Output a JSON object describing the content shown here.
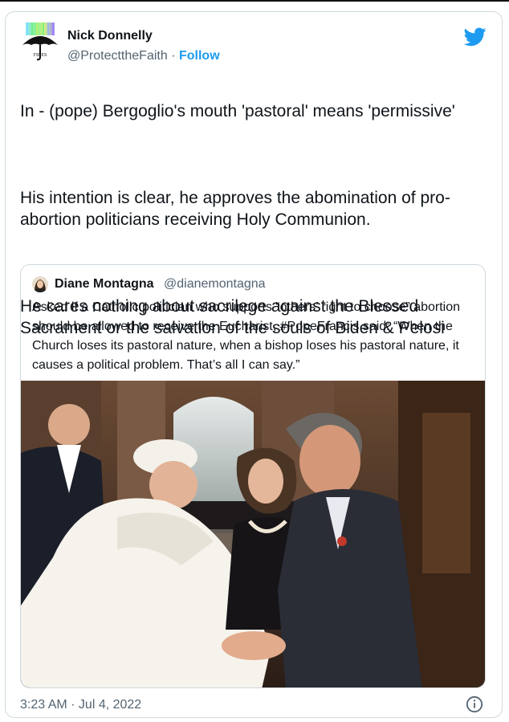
{
  "tweet": {
    "author": {
      "name": "Nick Donnelly",
      "handle": "@ProtecttheFaith",
      "separator": "·",
      "follow_label": "Follow",
      "avatar_text": "FIDES"
    },
    "paragraphs": [
      "In - (pope) Bergoglio's mouth 'pastoral' means 'permissive'",
      "His intention is clear, he approves the abomination of pro-abortion politicians receiving Holy Communion.",
      "He cares nothing about sacrilege against the Blessed Sacrament or the salvation of the souls of Biden & Pelosi"
    ],
    "quoted": {
      "name": "Diane Montagna",
      "handle": "@dianemontagna",
      "text": "Asked if a Catholic politician who supports “others’ right to choose” abortion should be allowed to receive the Eucharist, #PopeFrancis said: “When the Church loses its pastoral nature, when a bishop loses his pastoral nature, it causes a political problem. That’s all I can say.”"
    },
    "timestamp": "3:23 AM · Jul 4, 2022"
  },
  "icons": {
    "brand": "twitter-bird-icon",
    "info": "info-icon",
    "brand_color": "#1d9bf0"
  },
  "colors": {
    "text": "#0f1419",
    "secondary": "#536471",
    "border": "#cfd9de",
    "link": "#1d9bf0"
  }
}
